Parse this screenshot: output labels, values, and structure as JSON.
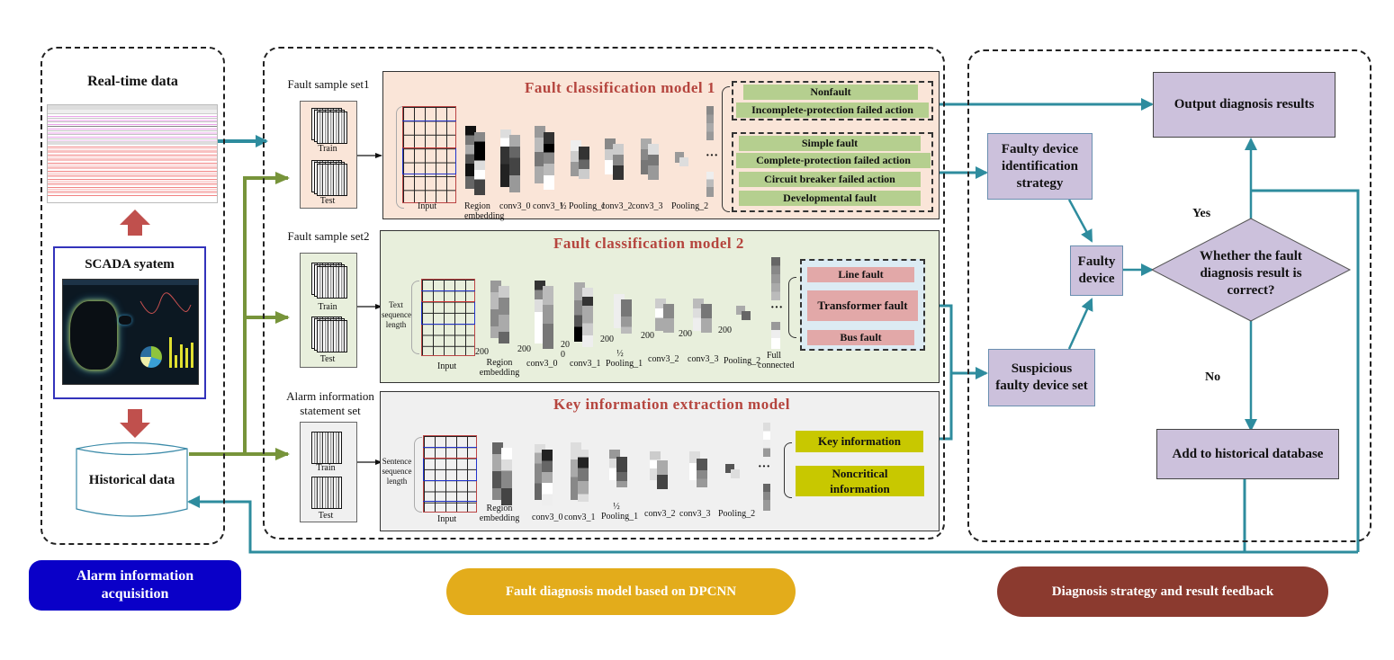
{
  "left_panel": {
    "realtime_title": "Real-time data",
    "scada_title": "SCADA syatem",
    "historical_title": "Historical data",
    "footer_label": "Alarm information acquisition",
    "footer_color": "#0a00c8"
  },
  "middle_panel": {
    "footer_label": "Fault diagnosis model based on DPCNN",
    "footer_color": "#e3ac1b",
    "train_label": "Train",
    "test_label": "Test",
    "models": [
      {
        "set_label": "Fault sample set1",
        "title": "Fault classification model 1",
        "bg_color": "#fae5d8",
        "layer_labels": [
          "Input",
          "Region embedding",
          "conv3_0",
          "conv3_1",
          "½ Pooling_1",
          "conv3_2",
          "conv3_3",
          "Pooling_2"
        ],
        "output_groups": [
          {
            "items": [
              "Nonfault",
              "Incomplete-protection failed action"
            ]
          },
          {
            "items": [
              "Simple fault",
              "Complete-protection failed action",
              "Circuit breaker failed action",
              "Developmental fault"
            ]
          }
        ]
      },
      {
        "set_label": "Fault sample set2",
        "title": "Fault classification model 2",
        "bg_color": "#e8efdc",
        "input_side_label": "Text sequence length",
        "dim_labels": [
          "200",
          "200",
          "20 0",
          "200",
          "200",
          "200",
          "200"
        ],
        "layer_labels": [
          "Input",
          "Region embedding",
          "conv3_0",
          "conv3_1",
          "½ Pooling_1",
          "conv3_2",
          "conv3_3",
          "Pooling_2",
          "Full connected"
        ],
        "output_groups": [
          {
            "items": [
              "Line fault",
              "Transformer fault",
              "Bus fault"
            ]
          }
        ]
      },
      {
        "set_label": "Alarm information statement set",
        "title": "Key information extraction model",
        "bg_color": "#f0f0f0",
        "input_side_label": "Sentence sequence length",
        "layer_labels": [
          "Input",
          "Region embedding",
          "conv3_0",
          "conv3_1",
          "½ Pooling_1",
          "conv3_2",
          "conv3_3",
          "Pooling_2"
        ],
        "output_groups": [
          {
            "items": [
              "Key information",
              "Noncritical information"
            ]
          }
        ]
      }
    ],
    "ellipsis": "···"
  },
  "right_panel": {
    "output_results": "Output diagnosis results",
    "identification_strategy": "Faulty device identification strategy",
    "faulty_device": "Faulty device",
    "suspicious_set": "Suspicious faulty device set",
    "decision": "Whether the fault diagnosis result is correct?",
    "yes_label": "Yes",
    "no_label": "No",
    "add_to_db": "Add to historical database",
    "footer_label": "Diagnosis strategy and result feedback",
    "footer_color": "#8b3a2f"
  },
  "colors": {
    "teal_arrow": "#2e8c9e",
    "green_arrow": "#77943a",
    "red_arrow": "#c0504d",
    "node_fill": "#ccc1dc"
  }
}
